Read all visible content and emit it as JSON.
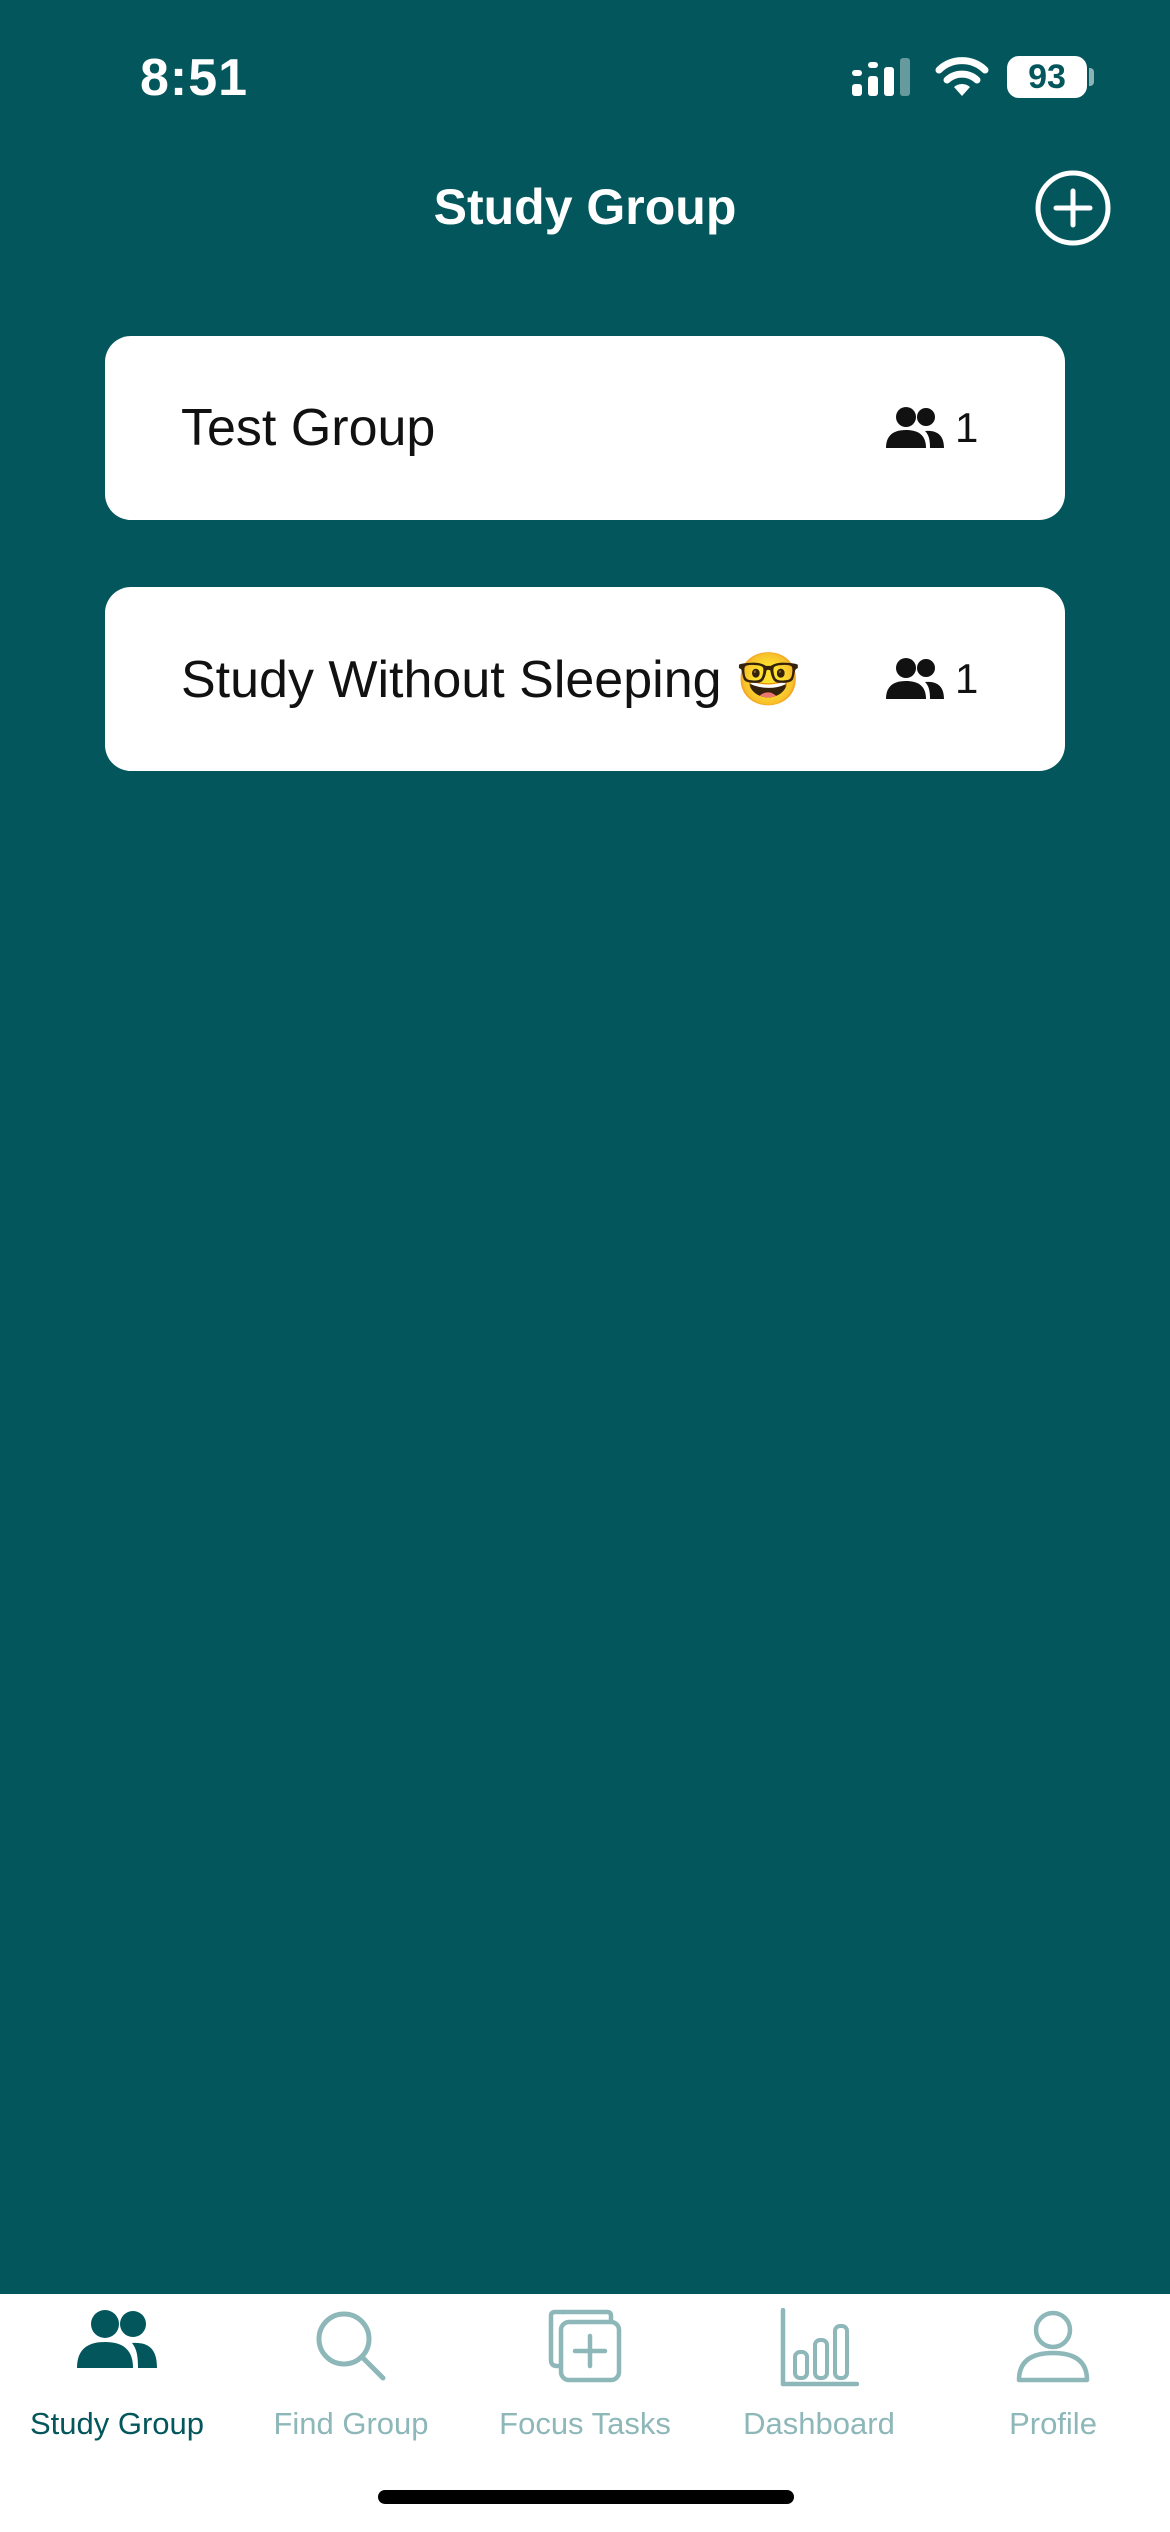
{
  "status_bar": {
    "time": "8:51",
    "battery": "93"
  },
  "header": {
    "title": "Study Group",
    "add_icon": "plus-circle-icon"
  },
  "groups": [
    {
      "name": "Test Group",
      "members": "1"
    },
    {
      "name": "Study Without Sleeping 🤓",
      "members": "1"
    }
  ],
  "tabs": [
    {
      "label": "Study Group",
      "icon": "people-icon",
      "active": true
    },
    {
      "label": "Find Group",
      "icon": "search-icon",
      "active": false
    },
    {
      "label": "Focus Tasks",
      "icon": "add-task-icon",
      "active": false
    },
    {
      "label": "Dashboard",
      "icon": "bar-chart-icon",
      "active": false
    },
    {
      "label": "Profile",
      "icon": "person-icon",
      "active": false
    }
  ],
  "colors": {
    "background": "#03575C",
    "card": "#FFFFFF",
    "tab_active": "#03575C",
    "tab_inactive": "#8DB7B8"
  }
}
